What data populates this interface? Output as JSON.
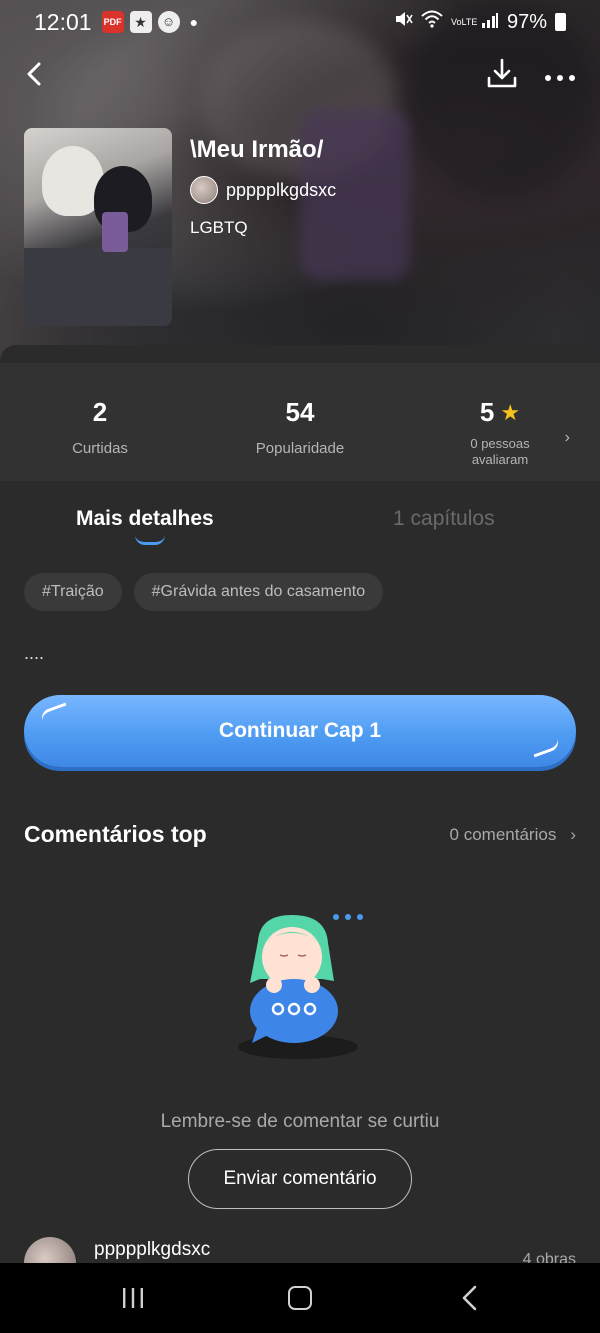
{
  "status_bar": {
    "time": "12:01",
    "battery": "97%",
    "network": "VoLTE"
  },
  "book": {
    "title": "\\Meu Irmão/",
    "author": "ppppplkgdsxc",
    "genre": "LGBTQ"
  },
  "stats": [
    {
      "value": "2",
      "label": "Curtidas"
    },
    {
      "value": "54",
      "label": "Popularidade"
    },
    {
      "value": "5",
      "label": "0 pessoas avaliaram"
    }
  ],
  "tabs": {
    "active": "Mais detalhes",
    "chapters": "1 capítulos"
  },
  "tags": [
    "#Traição",
    "#Grávida antes do casamento"
  ],
  "description": "....",
  "cta_label": "Continuar Cap 1",
  "comments": {
    "title": "Comentários top",
    "count": "0 comentários",
    "empty_text": "Lembre-se de comentar se curtiu",
    "send_label": "Enviar comentário"
  },
  "author_row": {
    "name": "ppppplkgdsxc",
    "works": "4 obras"
  },
  "colors": {
    "accent": "#4f9cf3",
    "star": "#f6c21b",
    "panel": "#2b2b2b"
  }
}
